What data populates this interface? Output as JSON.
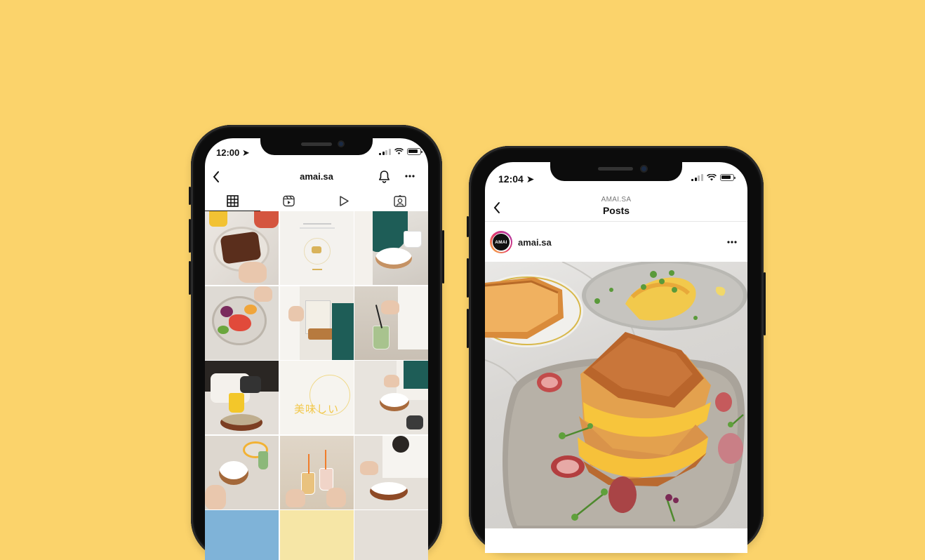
{
  "background_color": "#FBD36B",
  "left_phone": {
    "status": {
      "time": "12:00 ➤"
    },
    "header": {
      "back_icon": "chevron-left-icon",
      "username": "amai.sa",
      "bell_icon": "bell-icon",
      "more_icon": "more-horizontal-icon"
    },
    "tabs": [
      {
        "icon": "grid-icon",
        "active": true
      },
      {
        "icon": "reels-icon",
        "active": false
      },
      {
        "icon": "play-icon",
        "active": false
      },
      {
        "icon": "tagged-icon",
        "active": false
      }
    ],
    "grid_text": {
      "kanji_tile": "美味しい"
    }
  },
  "right_phone": {
    "status": {
      "time": "12:04 ➤"
    },
    "header": {
      "back_icon": "chevron-left-icon",
      "account": "AMAI.SA",
      "title": "Posts"
    },
    "post": {
      "avatar_text": "AMAI",
      "username": "amai.sa",
      "more_icon": "more-horizontal-icon"
    }
  }
}
